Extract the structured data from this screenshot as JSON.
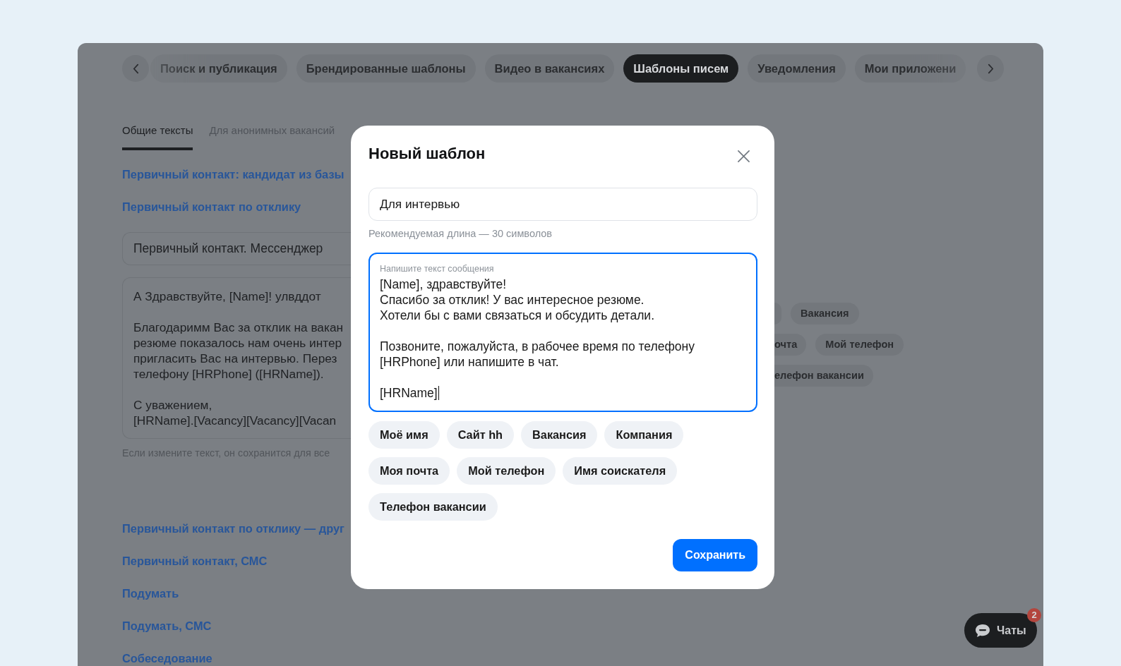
{
  "top_tabs": [
    {
      "label": "Поиск и публикация",
      "selected": false
    },
    {
      "label": "Брендированные шаблоны",
      "selected": false
    },
    {
      "label": "Видео в вакансиях",
      "selected": false
    },
    {
      "label": "Шаблоны писем",
      "selected": true
    },
    {
      "label": "Уведомления",
      "selected": false
    },
    {
      "label": "Мои приложени",
      "selected": false
    }
  ],
  "sub_tabs": [
    {
      "label": "Общие тексты",
      "selected": true
    },
    {
      "label": "Для анонимных вакансий",
      "selected": false
    }
  ],
  "template_links": [
    "Первичный контакт: кандидат из базы",
    "Первичный контакт по отклику"
  ],
  "template_editor": {
    "title_value": "Первичный контакт. Мессенджер",
    "text_value": "А Здравствуйте, [Name]! улвддот\n\nБлагодаримм Вас за отклик на вакан\nрезюме показалось нам очень интер\nпригласить Вас на интервью. Перез\nтелефону [HRPhone] ([HRName]).\n\nС уважением,\n[HRName].[Vacancy][Vacancy][Vacan",
    "hint": "Если измените текст, он сохранится для все"
  },
  "background_chip_rows": [
    {
      "chips": [
        {
          "kind": "clipped"
        },
        {
          "kind": "full",
          "label": "Вакансия"
        }
      ]
    },
    {
      "chips": [
        {
          "kind": "clipped",
          "label": "очта"
        },
        {
          "kind": "full",
          "label": "Мой телефон"
        }
      ]
    },
    {
      "chips": [
        {
          "kind": "clipped",
          "label": "елефон вакансии"
        }
      ]
    }
  ],
  "more_template_links": [
    "Первичный контакт по отклику — друг",
    "Первичный контакт, СМС",
    "Подумать",
    "Подумать, СМС",
    "Собеседование"
  ],
  "dialog": {
    "title": "Новый шаблон",
    "name_field": {
      "value": "Для интервью"
    },
    "name_hint": "Рекомендуемая длина — 30 символов",
    "message_field": {
      "label": "Напишите текст сообщения",
      "value": "[Name], здравствуйте!\nСпасибо за отклик! У вас интересное резюме.\nХотели бы с вами связаться и обсудить детали.\n\nПозвоните, пожалуйста, в рабочее время по телефону\n[HRPhone] или напишите в чат.\n\n[HRName]"
    },
    "variable_chips": [
      "Моё имя",
      "Сайт hh",
      "Вакансия",
      "Компания",
      "Моя почта",
      "Мой телефон",
      "Имя соискателя",
      "Телефон вакансии"
    ],
    "save_button": "Сохранить"
  },
  "chat_button": {
    "label": "Чаты",
    "badge": "2"
  }
}
